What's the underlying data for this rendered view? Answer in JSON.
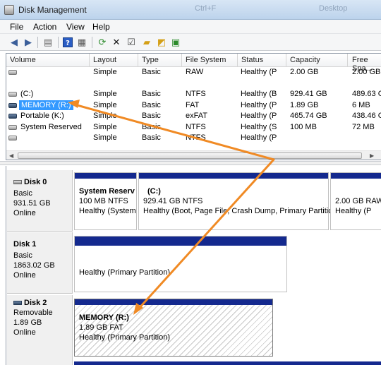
{
  "window": {
    "title": "Disk Management",
    "ghost_text_1": "Ctrl+F",
    "ghost_text_2": "Desktop"
  },
  "menu": {
    "file": "File",
    "action": "Action",
    "view": "View",
    "help": "Help"
  },
  "toolbar": {
    "buttons": [
      "back-arrow-icon",
      "forward-arrow-icon",
      "properties-icon",
      "help-icon",
      "console-tree-icon",
      "refresh-icon",
      "delete-icon",
      "open-icon",
      "explore-icon",
      "settings-icon"
    ]
  },
  "volume_table": {
    "columns": [
      "Volume",
      "Layout",
      "Type",
      "File System",
      "Status",
      "Capacity",
      "Free Spa..."
    ],
    "rows": [
      {
        "volume": "",
        "layout": "Simple",
        "type": "Basic",
        "fs": "RAW",
        "status": "Healthy (P",
        "capacity": "2.00 GB",
        "free": "2.00 GB"
      },
      {
        "volume": "",
        "layout": "",
        "type": "",
        "fs": "",
        "status": "",
        "capacity": "",
        "free": ""
      },
      {
        "volume": "(C:)",
        "layout": "Simple",
        "type": "Basic",
        "fs": "NTFS",
        "status": "Healthy (B",
        "capacity": "929.41 GB",
        "free": "489.63 GB"
      },
      {
        "volume": "MEMORY (R:)",
        "layout": "Simple",
        "type": "Basic",
        "fs": "FAT",
        "status": "Healthy (P",
        "capacity": "1.89 GB",
        "free": "6 MB"
      },
      {
        "volume": "Portable (K:)",
        "layout": "Simple",
        "type": "Basic",
        "fs": "exFAT",
        "status": "Healthy (P",
        "capacity": "465.74 GB",
        "free": "438.46 GB"
      },
      {
        "volume": "System Reserved",
        "layout": "Simple",
        "type": "Basic",
        "fs": "NTFS",
        "status": "Healthy (S",
        "capacity": "100 MB",
        "free": "72 MB"
      },
      {
        "volume": "",
        "layout": "Simple",
        "type": "Basic",
        "fs": "NTFS",
        "status": "Healthy (P",
        "capacity": "",
        "free": ""
      }
    ]
  },
  "disks": [
    {
      "name": "Disk 0",
      "type": "Basic",
      "size": "931.51 GB",
      "state": "Online",
      "partitions": [
        {
          "name": "System Reserv",
          "info": "100 MB NTFS",
          "status": "Healthy (System"
        },
        {
          "name": "(C:)",
          "info": "929.41 GB NTFS",
          "status": "Healthy (Boot, Page File, Crash Dump, Primary Partitic"
        },
        {
          "name": "",
          "info": "2.00 GB RAW",
          "status": "Healthy (P"
        }
      ]
    },
    {
      "name": "Disk 1",
      "type": "Basic",
      "size": "1863.02 GB",
      "state": "Online",
      "partitions": [
        {
          "name": "",
          "info": "",
          "status": "Healthy (Primary Partition)"
        }
      ]
    },
    {
      "name": "Disk 2",
      "type": "Removable",
      "size": "1.89 GB",
      "state": "Online",
      "partitions": [
        {
          "name": "MEMORY  (R:)",
          "info": "1.89 GB FAT",
          "status": "Healthy (Primary Partition)"
        }
      ]
    }
  ],
  "colors": {
    "selection": "#3399ff",
    "partition_bar": "#14298e",
    "annotation_arrow": "#f08a24"
  }
}
